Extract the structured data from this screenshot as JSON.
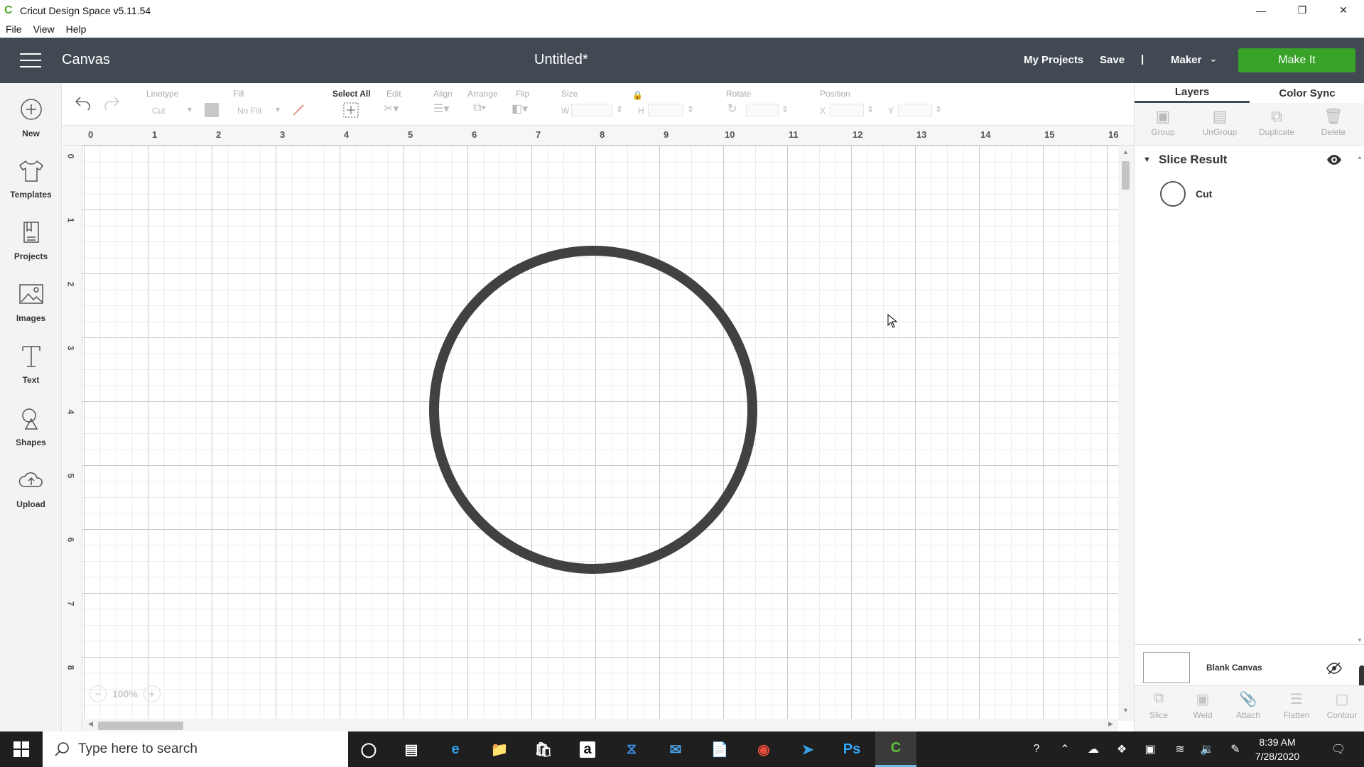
{
  "window": {
    "title": "Cricut Design Space  v5.11.54",
    "controls": [
      "minimize-icon",
      "restore-icon",
      "close-icon"
    ]
  },
  "menubar": {
    "items": [
      "File",
      "View",
      "Help"
    ]
  },
  "header": {
    "section": "Canvas",
    "document_title": "Untitled*",
    "my_projects": "My Projects",
    "save": "Save",
    "separator": "|",
    "machine": "Maker",
    "make_it": "Make It",
    "accent_color": "#38a229",
    "bar_color": "#414a52"
  },
  "sidebar": {
    "items": [
      {
        "label": "New",
        "icon": "plus-circle-icon"
      },
      {
        "label": "Templates",
        "icon": "tshirt-icon"
      },
      {
        "label": "Projects",
        "icon": "projects-icon"
      },
      {
        "label": "Images",
        "icon": "image-icon"
      },
      {
        "label": "Text",
        "icon": "text-t-icon"
      },
      {
        "label": "Shapes",
        "icon": "shapes-icon"
      },
      {
        "label": "Upload",
        "icon": "cloud-upload-icon"
      }
    ]
  },
  "toolbar": {
    "linetype_label": "Linetype",
    "linetype_value": "Cut",
    "fill_label": "Fill",
    "fill_value": "No Fill",
    "select_all": "Select All",
    "edit": "Edit",
    "align": "Align",
    "arrange": "Arrange",
    "flip": "Flip",
    "size": "Size",
    "w": "W",
    "h": "H",
    "rotate": "Rotate",
    "position": "Position",
    "x": "X",
    "y": "Y"
  },
  "ruler": {
    "top": [
      "0",
      "1",
      "2",
      "3",
      "4",
      "5",
      "6",
      "7",
      "8",
      "9",
      "10",
      "11",
      "12",
      "13",
      "14",
      "15",
      "16"
    ],
    "left": [
      "0",
      "1",
      "2",
      "3",
      "4",
      "5",
      "6",
      "7",
      "8"
    ]
  },
  "zoom": {
    "level": "100%"
  },
  "right_panel": {
    "tabs": [
      "Layers",
      "Color Sync"
    ],
    "actions": [
      "Group",
      "UnGroup",
      "Duplicate",
      "Delete"
    ],
    "group_title": "Slice Result",
    "layer_name": "Cut",
    "blank_canvas": "Blank Canvas",
    "bottom_actions": [
      "Slice",
      "Weld",
      "Attach",
      "Flatten",
      "Contour"
    ]
  },
  "taskbar": {
    "search_placeholder": "Type here to search",
    "time": "8:39 AM",
    "date": "7/28/2020",
    "apps": [
      "cortana-icon",
      "task-view-icon",
      "edge-icon",
      "file-explorer-icon",
      "store-icon",
      "amazon-icon",
      "bolt-app-icon",
      "mail-icon",
      "notepad-icon",
      "chrome-icon",
      "bird-app-icon",
      "photoshop-icon",
      "cricut-icon"
    ]
  }
}
